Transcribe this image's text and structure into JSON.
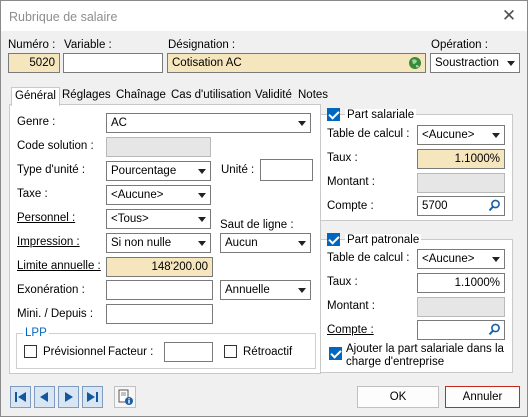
{
  "window": {
    "title": "Rubrique de salaire",
    "close_glyph": "✕"
  },
  "header": {
    "numero_label": "Numéro :",
    "numero_value": "5020",
    "variable_label": "Variable :",
    "variable_value": "",
    "designation_label": "Désignation :",
    "designation_value": "Cotisation AC",
    "operation_label": "Opération :",
    "operation_value": "Soustraction"
  },
  "tabs": [
    "Général",
    "Réglages",
    "Chaînage",
    "Cas d'utilisation",
    "Validité",
    "Notes"
  ],
  "general": {
    "genre_label": "Genre :",
    "genre_value": "AC",
    "code_solution_label": "Code solution :",
    "type_unite_label": "Type d'unité :",
    "type_unite_value": "Pourcentage",
    "unite_label": "Unité :",
    "unite_value": "",
    "taxe_label": "Taxe :",
    "taxe_value": "<Aucune>",
    "personnel_label": "Personnel :",
    "personnel_value": "<Tous>",
    "saut_label": "Saut de ligne :",
    "saut_value": "Aucun",
    "impression_label": "Impression :",
    "impression_value": "Si non nulle",
    "limite_label": "Limite annuelle :",
    "limite_value": "148'200.00",
    "exoneration_label": "Exonération :",
    "exoneration_value": "",
    "exoneration_period": "Annuelle",
    "mini_label": "Mini. / Depuis :",
    "mini_value": "",
    "lpp_legend": "LPP",
    "previsionnel_label": "Prévisionnel",
    "facteur_label": "Facteur :",
    "facteur_value": "",
    "retroactif_label": "Rétroactif"
  },
  "part_salariale": {
    "title": "Part salariale",
    "checked": true,
    "table_label": "Table de calcul :",
    "table_value": "<Aucune>",
    "taux_label": "Taux :",
    "taux_value": "1.1000%",
    "montant_label": "Montant :",
    "montant_value": "",
    "compte_label": "Compte :",
    "compte_value": "5700"
  },
  "part_patronale": {
    "title": "Part patronale",
    "checked": true,
    "table_label": "Table de calcul :",
    "table_value": "<Aucune>",
    "taux_label": "Taux :",
    "taux_value": "1.1000%",
    "montant_label": "Montant :",
    "montant_value": "",
    "compte_label": "Compte :",
    "compte_value": "",
    "ajouter_label_1": "Ajouter la part salariale dans la",
    "ajouter_label_2": "charge d'entreprise"
  },
  "footer": {
    "ok_label": "OK",
    "cancel_label": "Annuler"
  },
  "colors": {
    "accent": "#0067c0",
    "yellow_field": "#f5e6bd",
    "cancel_border": "#c42b1c"
  }
}
